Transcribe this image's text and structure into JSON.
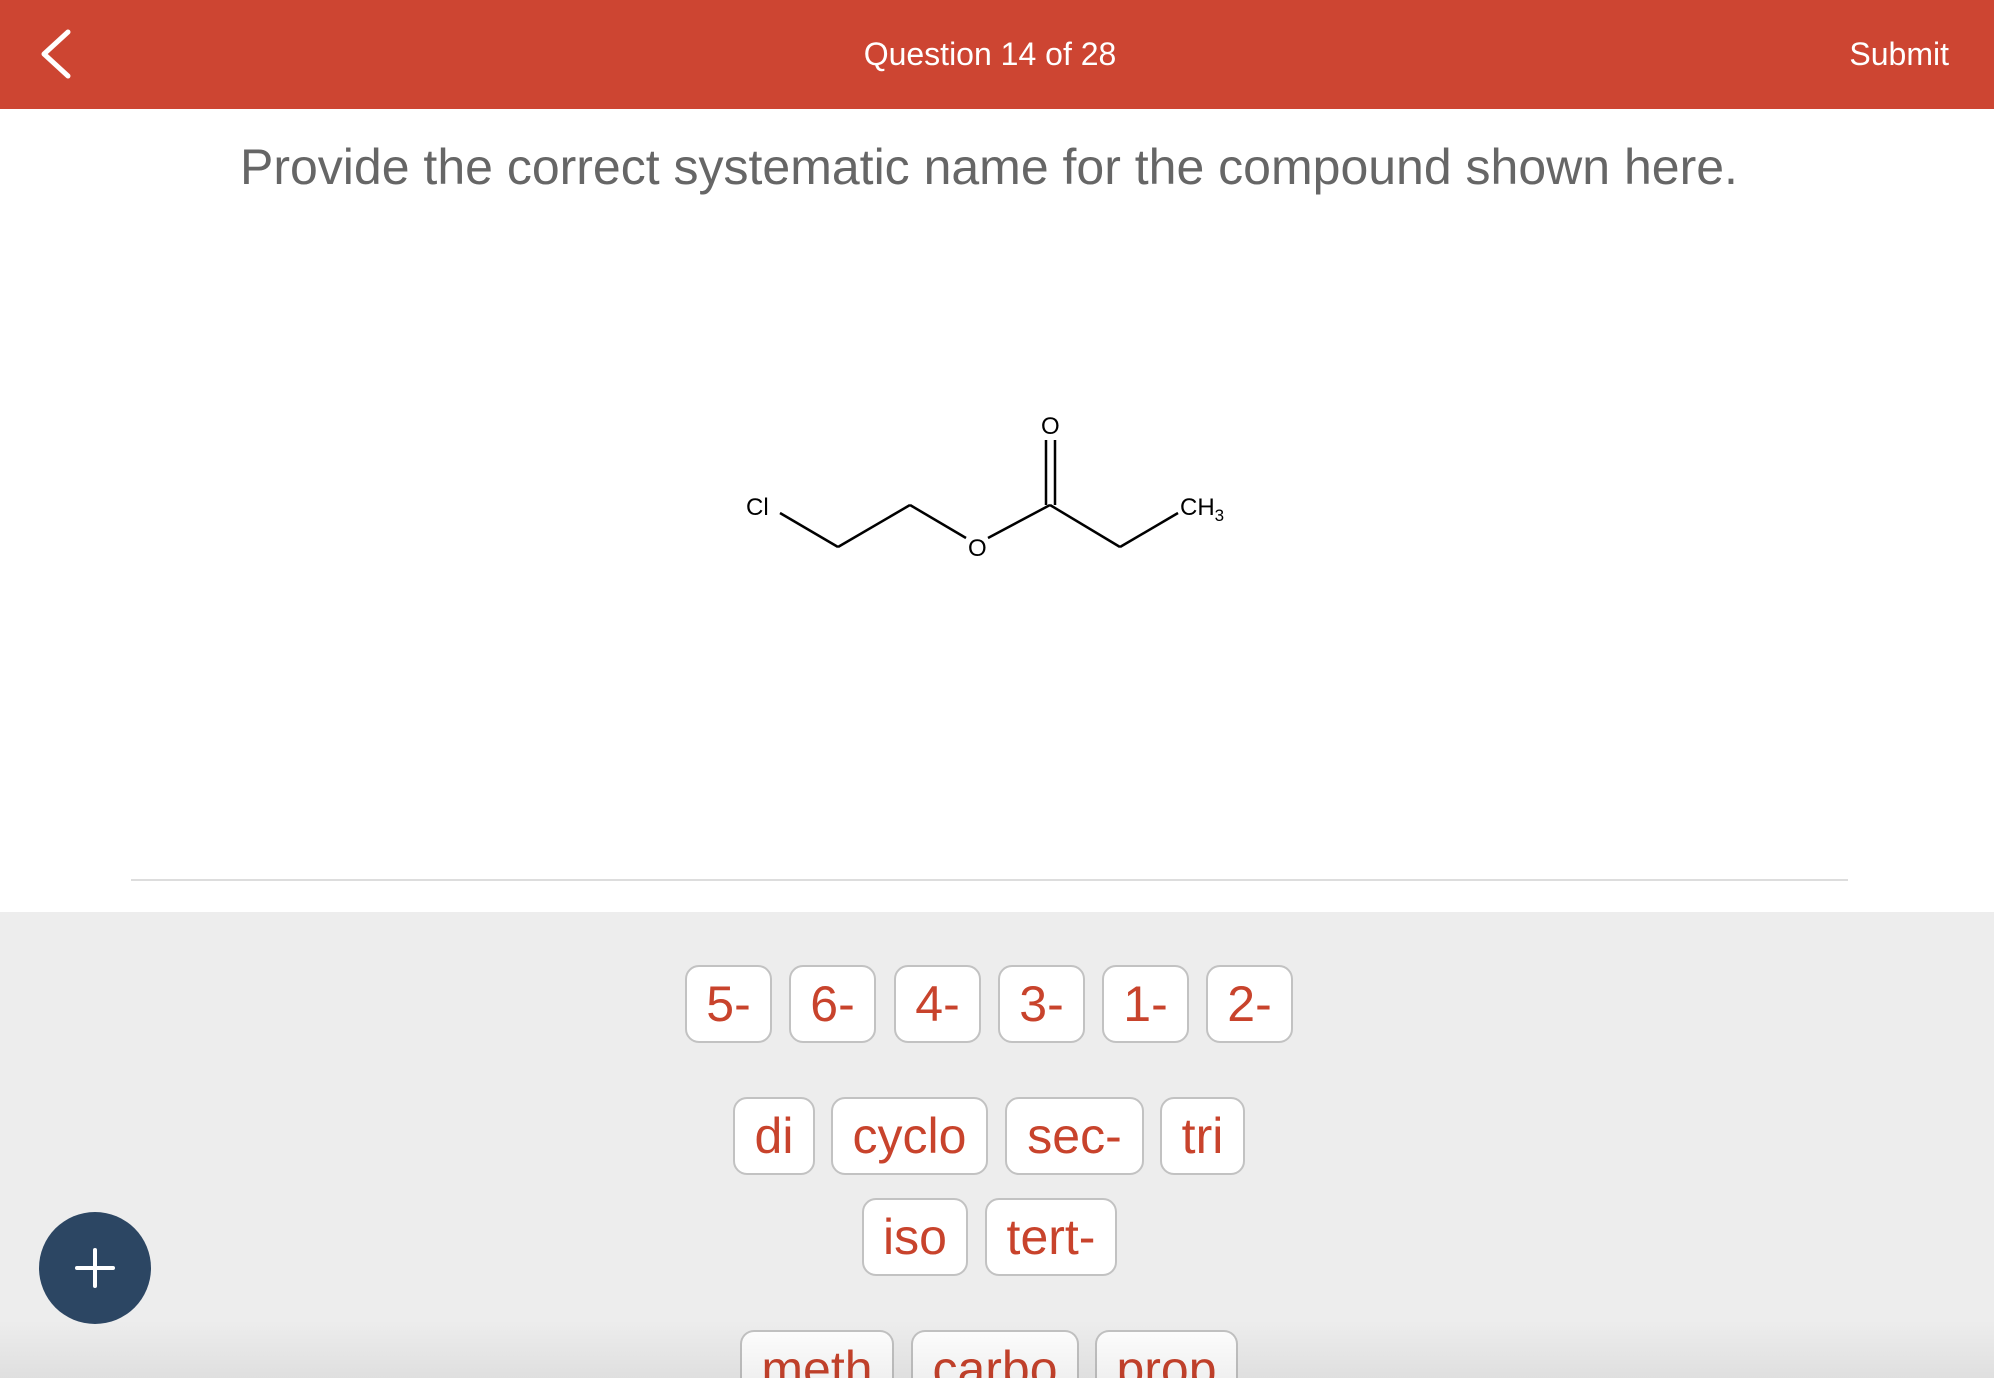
{
  "header": {
    "title": "Question 14 of 28",
    "submit_label": "Submit"
  },
  "question": {
    "prompt": "Provide the correct systematic name for the compound shown here."
  },
  "structure": {
    "labels": {
      "chlorine": "Cl",
      "carbonyl_oxygen": "O",
      "ester_oxygen": "O",
      "methyl": "CH",
      "methyl_subscript": "3"
    }
  },
  "tiles": {
    "locants": [
      "5-",
      "6-",
      "4-",
      "3-",
      "1-",
      "2-"
    ],
    "prefixes_row1": [
      "di",
      "cyclo",
      "sec-",
      "tri"
    ],
    "prefixes_row2": [
      "iso",
      "tert-"
    ],
    "roots_partial": [
      "meth",
      "carbo",
      "prop"
    ]
  },
  "colors": {
    "header": "#cd4532",
    "tile_text": "#c8432c",
    "tray_background": "#ededed",
    "fab": "#2c4663"
  },
  "icons": {
    "back": "chevron-left-icon",
    "add": "plus-icon"
  }
}
